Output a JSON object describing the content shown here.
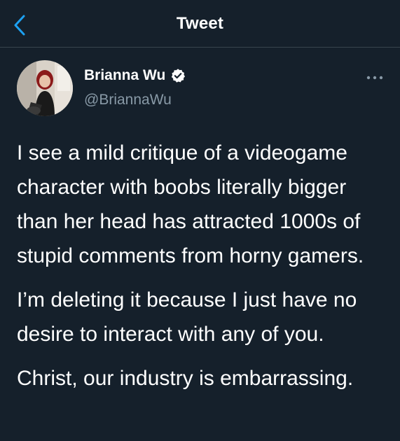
{
  "header": {
    "title": "Tweet",
    "back_icon": "chevron-left-icon"
  },
  "colors": {
    "background": "#15202b",
    "accent": "#1da1f2",
    "secondary_text": "#8899a6",
    "divider": "#38444d"
  },
  "author": {
    "name": "Brianna Wu",
    "handle": "@BriannaWu",
    "verified": true,
    "verified_icon": "verified-badge-icon"
  },
  "more_icon": "more-horizontal-icon",
  "tweet": {
    "paragraphs": [
      "I see a mild critique of a videogame character with boobs literally bigger than her head has attracted 1000s of stupid comments from horny gamers.",
      "I’m deleting it because I just have no desire to interact with any of you.",
      "Christ, our industry is embarrassing."
    ]
  }
}
